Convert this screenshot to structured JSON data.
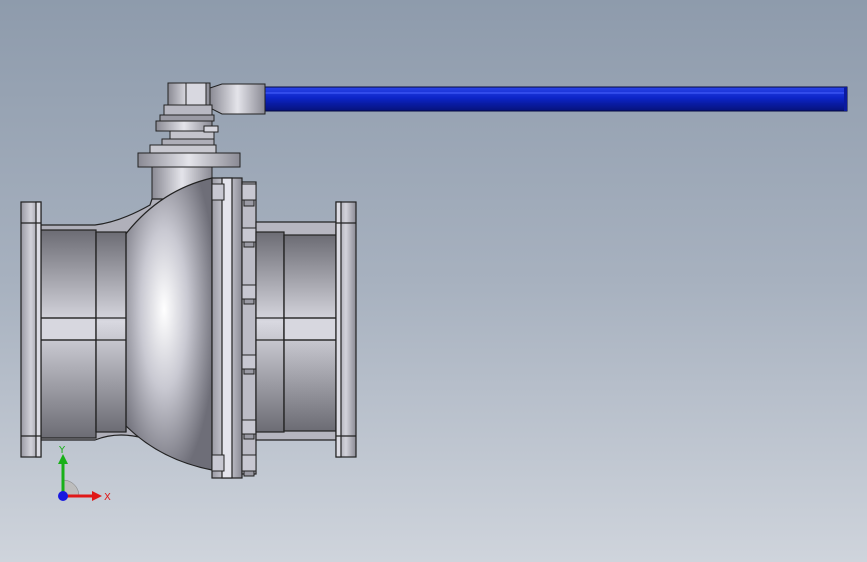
{
  "viewport": {
    "background_top": "#8e9bac",
    "background_bottom": "#cfd4dc"
  },
  "model": {
    "handle_color": "#1030d8",
    "body_color": "#c7c7cf",
    "edge_color": "#2a2a2a"
  },
  "triad": {
    "x_label": "X",
    "y_label": "Y",
    "x_color": "#e01818",
    "y_color": "#18b018",
    "z_color": "#1818e0"
  }
}
